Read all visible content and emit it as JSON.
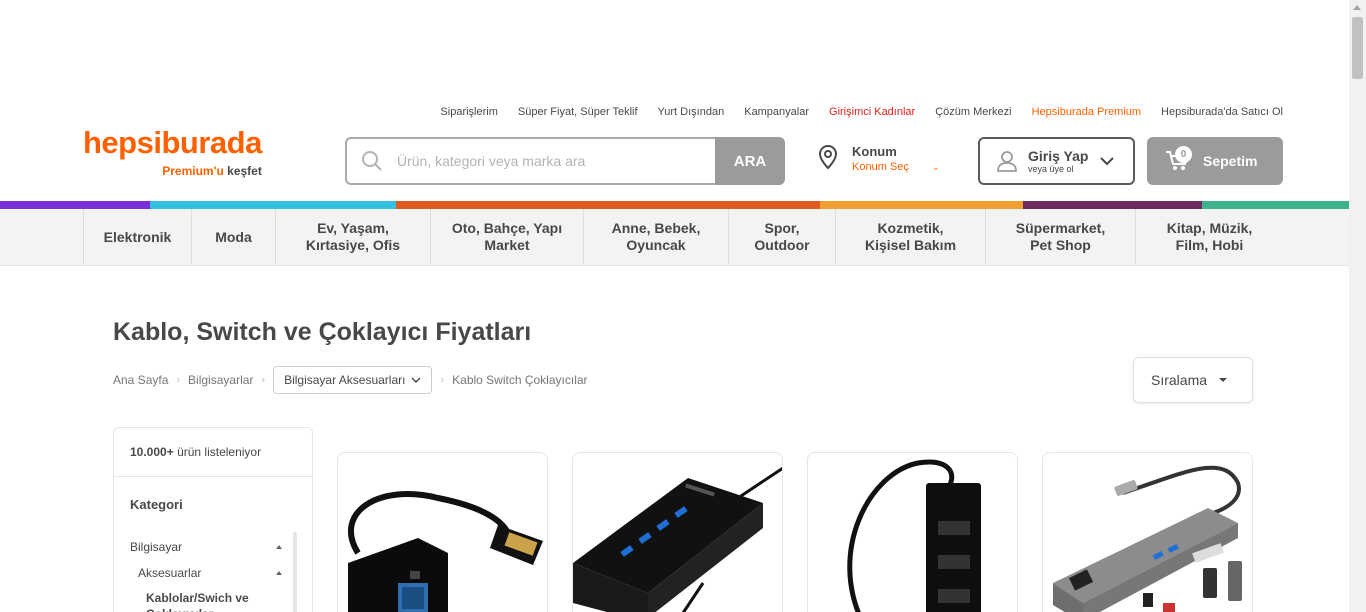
{
  "top_links": [
    {
      "label": "Siparişlerim",
      "color": "#484848"
    },
    {
      "label": "Süper Fiyat, Süper Teklif",
      "color": "#484848"
    },
    {
      "label": "Yurt Dışından",
      "color": "#484848"
    },
    {
      "label": "Kampanyalar",
      "color": "#484848"
    },
    {
      "label": "Girişimci Kadınlar",
      "color": "#e2231a"
    },
    {
      "label": "Çözüm Merkezi",
      "color": "#484848"
    },
    {
      "label": "Hepsiburada Premium",
      "color": "#ff6000"
    },
    {
      "label": "Hepsiburada'da Satıcı Ol",
      "color": "#484848"
    }
  ],
  "logo": {
    "name": "hepsiburada",
    "sub_premium": "Premium'u",
    "sub_kesfet": "keşfet"
  },
  "search": {
    "placeholder": "Ürün, kategori veya marka ara",
    "button": "ARA"
  },
  "location": {
    "title": "Konum",
    "subtitle": "Konum Seç"
  },
  "login": {
    "title": "Giriş Yap",
    "subtitle": "veya üye ol"
  },
  "cart": {
    "label": "Sepetim",
    "count": "0"
  },
  "color_bar": [
    "#7b2fd4",
    "#34c0e0",
    "#e05b22",
    "#f0a030",
    "#6e2a5e",
    "#3cb38a"
  ],
  "categories": [
    "Elektronik",
    "Moda",
    "Ev, Yaşam,\nKırtasiye, Ofis",
    "Oto, Bahçe, Yapı\nMarket",
    "Anne, Bebek,\nOyuncak",
    "Spor,\nOutdoor",
    "Kozmetik,\nKişisel Bakım",
    "Süpermarket,\nPet Shop",
    "Kitap, Müzik,\nFilm, Hobi"
  ],
  "page_title": "Kablo, Switch ve Çoklayıcı Fiyatları",
  "breadcrumb": {
    "home": "Ana Sayfa",
    "level1": "Bilgisayarlar",
    "level2": "Bilgisayar Aksesuarları",
    "current": "Kablo Switch Çoklayıcılar"
  },
  "sort_label": "Sıralama",
  "filter": {
    "count_bold": "10.000+",
    "count_text": "ürün listeleniyor",
    "category_title": "Kategori",
    "tree": [
      "Bilgisayar",
      "Aksesuarlar",
      "Kablolar/Swich ve Çoklayıcılar"
    ]
  },
  "products": [
    {
      "icon": "vga-adapter-image"
    },
    {
      "icon": "usb-hub-4port-image"
    },
    {
      "icon": "usb-hub-vertical-image"
    },
    {
      "icon": "usb-c-multiport-image"
    }
  ]
}
